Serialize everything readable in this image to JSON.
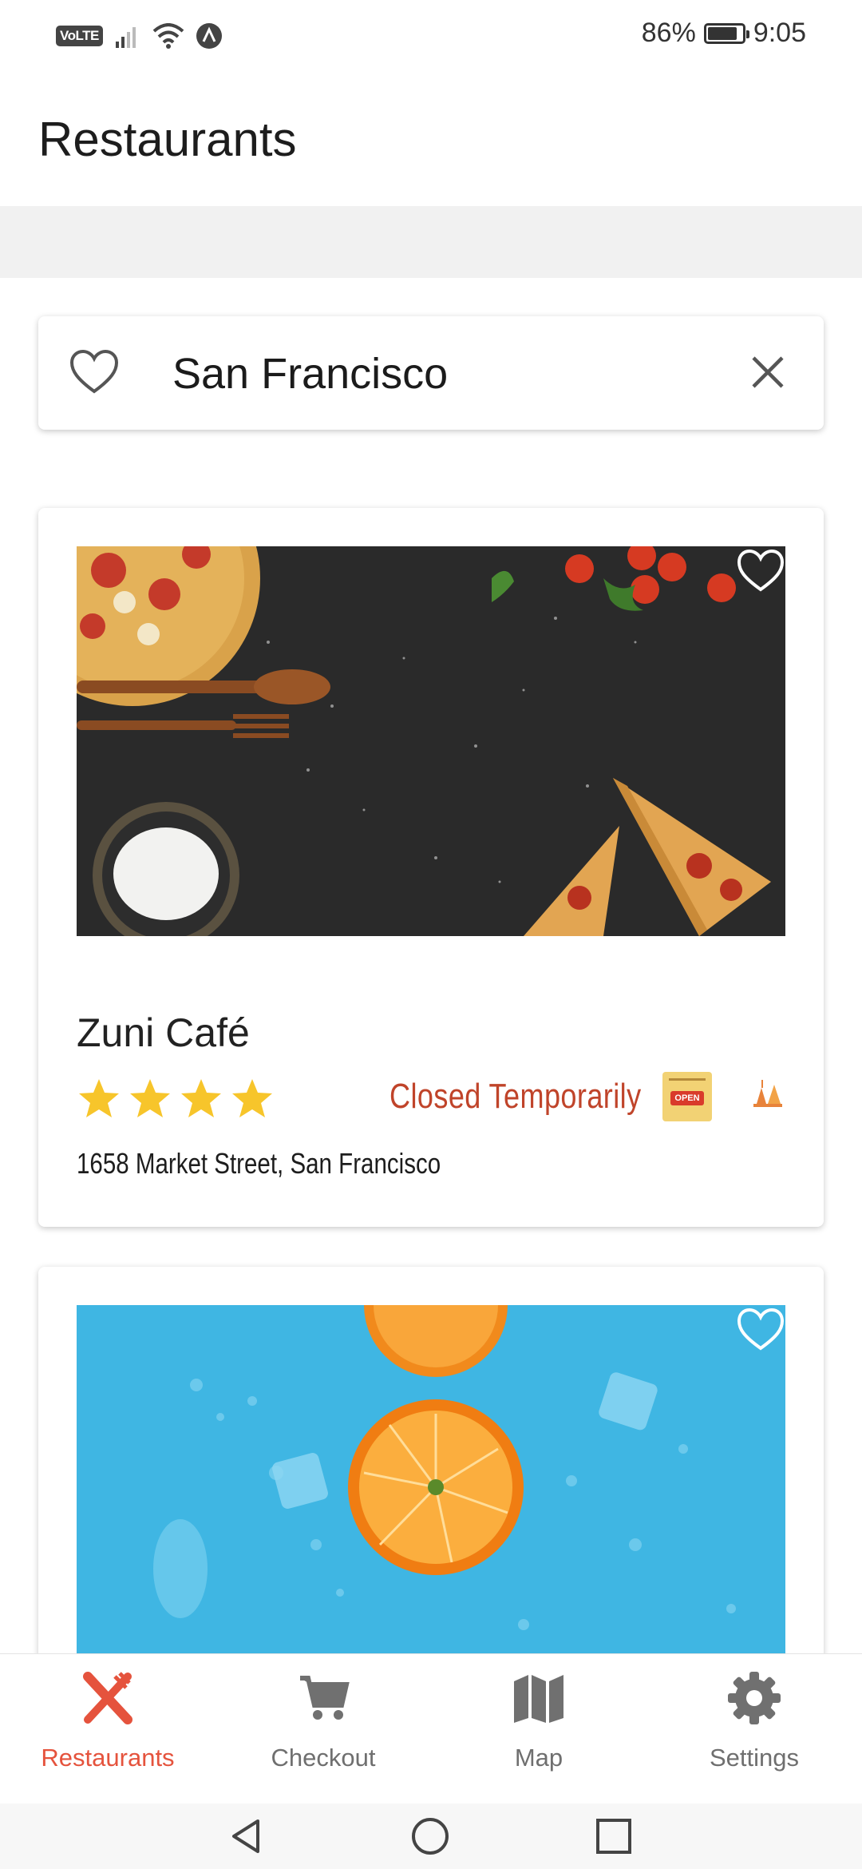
{
  "status_bar": {
    "network_badge": "VoLTE",
    "battery_percent": "86%",
    "battery_level": 0.86,
    "time": "9:05"
  },
  "header": {
    "title": "Restaurants"
  },
  "search": {
    "value": "San Francisco",
    "favorite_icon": "heart-outline-icon",
    "clear_icon": "close-icon"
  },
  "restaurants": [
    {
      "name": "Zuni Café",
      "rating": 4,
      "status": "Closed Temporarily",
      "address": "1658 Market Street, San Francisco",
      "open_badge_text": "OPEN",
      "status_color": "#c0442a"
    },
    {
      "name": "",
      "rating": null,
      "status": "",
      "address": ""
    }
  ],
  "bottom_nav": {
    "items": [
      {
        "label": "Restaurants",
        "icon": "fork-knife-icon",
        "active": true
      },
      {
        "label": "Checkout",
        "icon": "cart-icon",
        "active": false
      },
      {
        "label": "Map",
        "icon": "map-icon",
        "active": false
      },
      {
        "label": "Settings",
        "icon": "gear-icon",
        "active": false
      }
    ],
    "active_color": "#e5533d"
  },
  "system_nav": {
    "back_icon": "back-triangle-icon",
    "home_icon": "home-circle-icon",
    "recents_icon": "recents-square-icon"
  }
}
